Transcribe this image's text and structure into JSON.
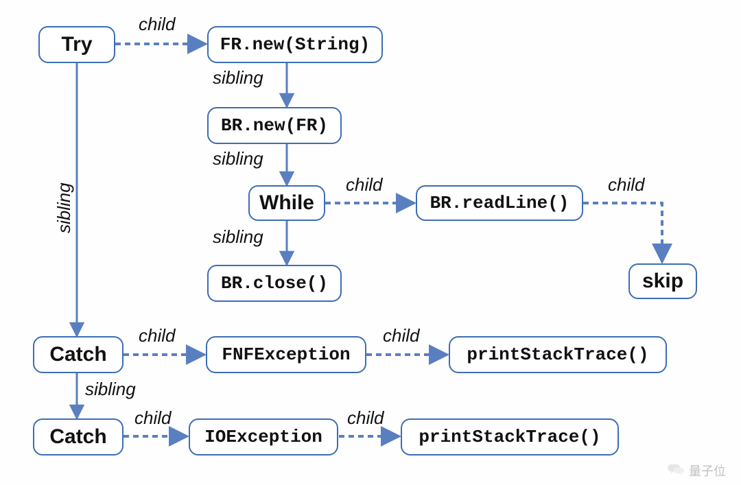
{
  "nodes": {
    "try": {
      "label": "Try"
    },
    "fr_new": {
      "label": "FR.new(String)"
    },
    "br_new": {
      "label": "BR.new(FR)"
    },
    "while": {
      "label": "While"
    },
    "br_read": {
      "label": "BR.readLine()"
    },
    "skip": {
      "label": "skip"
    },
    "br_close": {
      "label": "BR.close()"
    },
    "catch1": {
      "label": "Catch"
    },
    "fnf": {
      "label": "FNFException"
    },
    "pst1": {
      "label": "printStackTrace()"
    },
    "catch2": {
      "label": "Catch"
    },
    "ioe": {
      "label": "IOException"
    },
    "pst2": {
      "label": "printStackTrace()"
    }
  },
  "edge_labels": {
    "child": "child",
    "sibling": "sibling"
  },
  "watermark": "量子位"
}
